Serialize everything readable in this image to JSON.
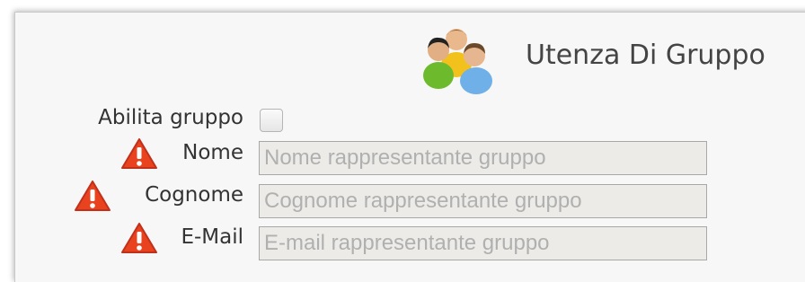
{
  "header": {
    "title": "Utenza Di Gruppo",
    "icon": "group-users-icon"
  },
  "form": {
    "enable_group": {
      "label": "Abilita gruppo",
      "checked": false
    },
    "nome": {
      "label": "Nome",
      "placeholder": "Nome rappresentante gruppo",
      "value": "",
      "icon": "warning-icon"
    },
    "cognome": {
      "label": "Cognome",
      "placeholder": "Cognome rappresentante gruppo",
      "value": "",
      "icon": "warning-icon"
    },
    "email": {
      "label": "E-Mail",
      "placeholder": "E-mail rappresentante gruppo",
      "value": "",
      "icon": "warning-icon"
    }
  },
  "colors": {
    "warning": "#e8421f",
    "field_bg": "#ecebe7",
    "panel_bg": "#f7f7f7"
  }
}
